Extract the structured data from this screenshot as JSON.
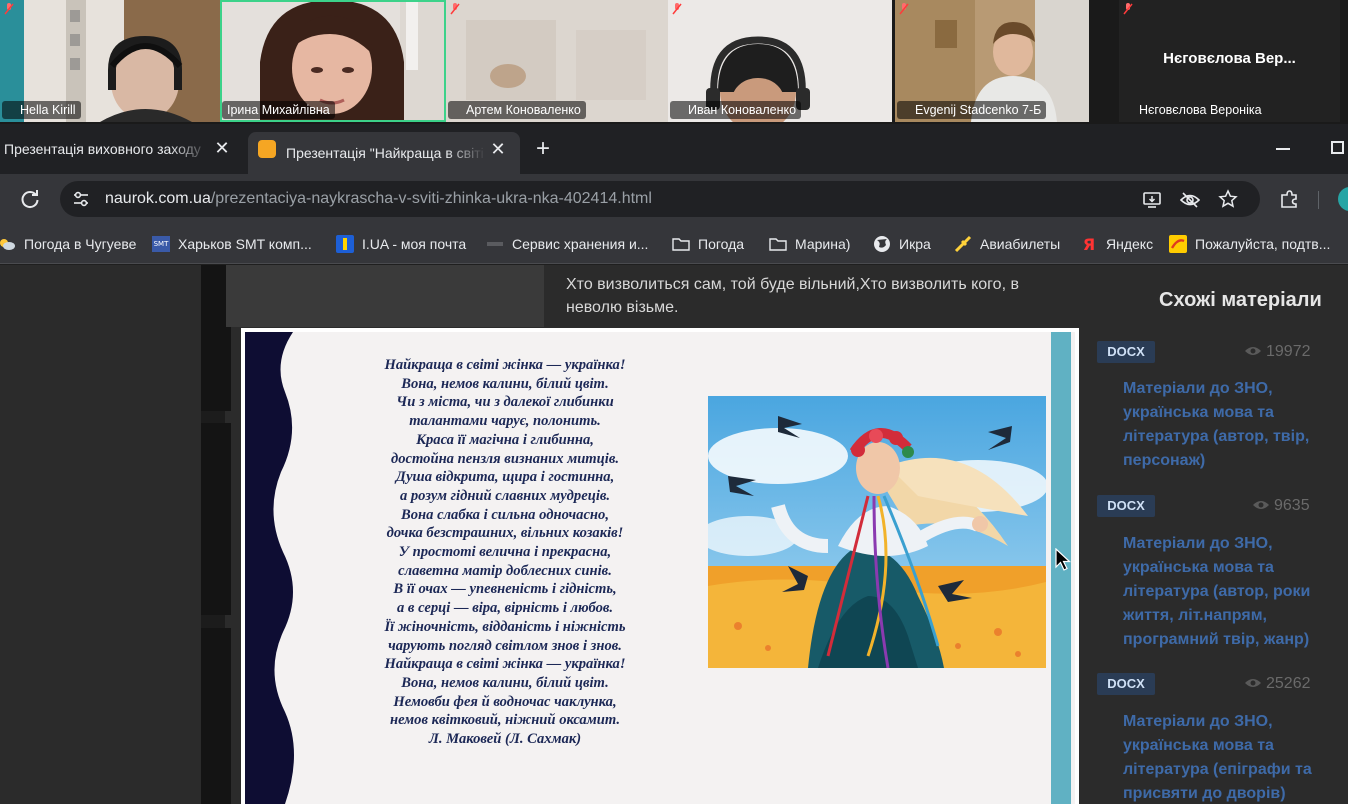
{
  "meeting": {
    "participants": [
      {
        "name": "Hella Kirill",
        "muted": true,
        "active": false
      },
      {
        "name": "Ірина Михайлівна",
        "muted": false,
        "active": true
      },
      {
        "name": "Артем Коноваленко",
        "muted": true,
        "active": false
      },
      {
        "name": "Иван Коноваленко",
        "muted": true,
        "active": false
      },
      {
        "name": "Evgenij Stadcenko 7-Б",
        "muted": true,
        "active": false
      },
      {
        "name": "Нєговєлова Вероніка",
        "muted": true,
        "active": false,
        "display_name": "Нєговєлова Вер..."
      }
    ]
  },
  "browser": {
    "tabs": [
      {
        "label": "Презентація виховного заходу",
        "active": false
      },
      {
        "label": "Презентація \"Найкраща в світі",
        "active": true
      }
    ],
    "new_tab_icon": "plus-icon",
    "url_host": "naurok.com.ua",
    "url_path": "/prezentaciya-naykrascha-v-sviti-zhinka-ukra-nka-402414.html",
    "bookmarks": [
      {
        "label": "Погода в Чугуеве",
        "icon": "weather-icon"
      },
      {
        "label": "Харьков SMT комп...",
        "icon": "smt-icon"
      },
      {
        "label": "I.UA - моя почта",
        "icon": "iua-icon"
      },
      {
        "label": "Сервис хранения и...",
        "icon": "storage-icon"
      },
      {
        "label": "Погода",
        "icon": "folder-icon"
      },
      {
        "label": "Марина)",
        "icon": "folder-icon"
      },
      {
        "label": "Икра",
        "icon": "globe-icon"
      },
      {
        "label": "Авиабилеты",
        "icon": "plane-icon"
      },
      {
        "label": "Яндекс",
        "icon": "yandex-icon"
      },
      {
        "label": "Пожалуйста, подтв...",
        "icon": "confirm-icon"
      }
    ]
  },
  "page": {
    "quote": "Хто визволиться сам, той буде вільний,Хто визволить кого, в неволю візьме.",
    "sidebar_title": "Схожі матеріали",
    "related": [
      {
        "type": "DOCX",
        "views": "19972",
        "title": "Матеріали до ЗНО, українська мова та література (автор, твір, персонаж)"
      },
      {
        "type": "DOCX",
        "views": "9635",
        "title": "Матеріали до ЗНО, українська мова та література (автор, роки життя, літ.напрям, програмний твір, жанр)"
      },
      {
        "type": "DOCX",
        "views": "25262",
        "title": "Матеріали до ЗНО, українська мова та література (епіграфи та присвяти до дворів)"
      }
    ]
  },
  "slide": {
    "poem_lines": [
      "Найкраща в світі жінка — українка!",
      "Вона, немов калини, білий цвіт.",
      "Чи з міста, чи з далекої глибинки",
      "талантами чарує, полонить.",
      "Краса її магічна і глибинна,",
      "достойна пензля визнаних митців.",
      "Душа відкрита, щира і гостинна,",
      "а розум гідний славних мудреців.",
      "Вона слабка і сильна одночасно,",
      "дочка безстрашних, вільних козаків!",
      "У простоті велична і прекрасна,",
      "славетна матір доблесних синів.",
      "В її очах — упевненість і гідність,",
      "а в серці — віра, вірність і любов.",
      "Її жіночність, відданість і ніжність",
      "чарують погляд світлом знов і знов.",
      "Найкраща в світі жінка — українка!",
      "Вона, немов калини, білий цвіт.",
      "Немовби фея й водночас чаклунка,",
      "немов квітковий, ніжний оксамит.",
      "Л.  Маковей  (Л.  Сахмак)"
    ]
  }
}
